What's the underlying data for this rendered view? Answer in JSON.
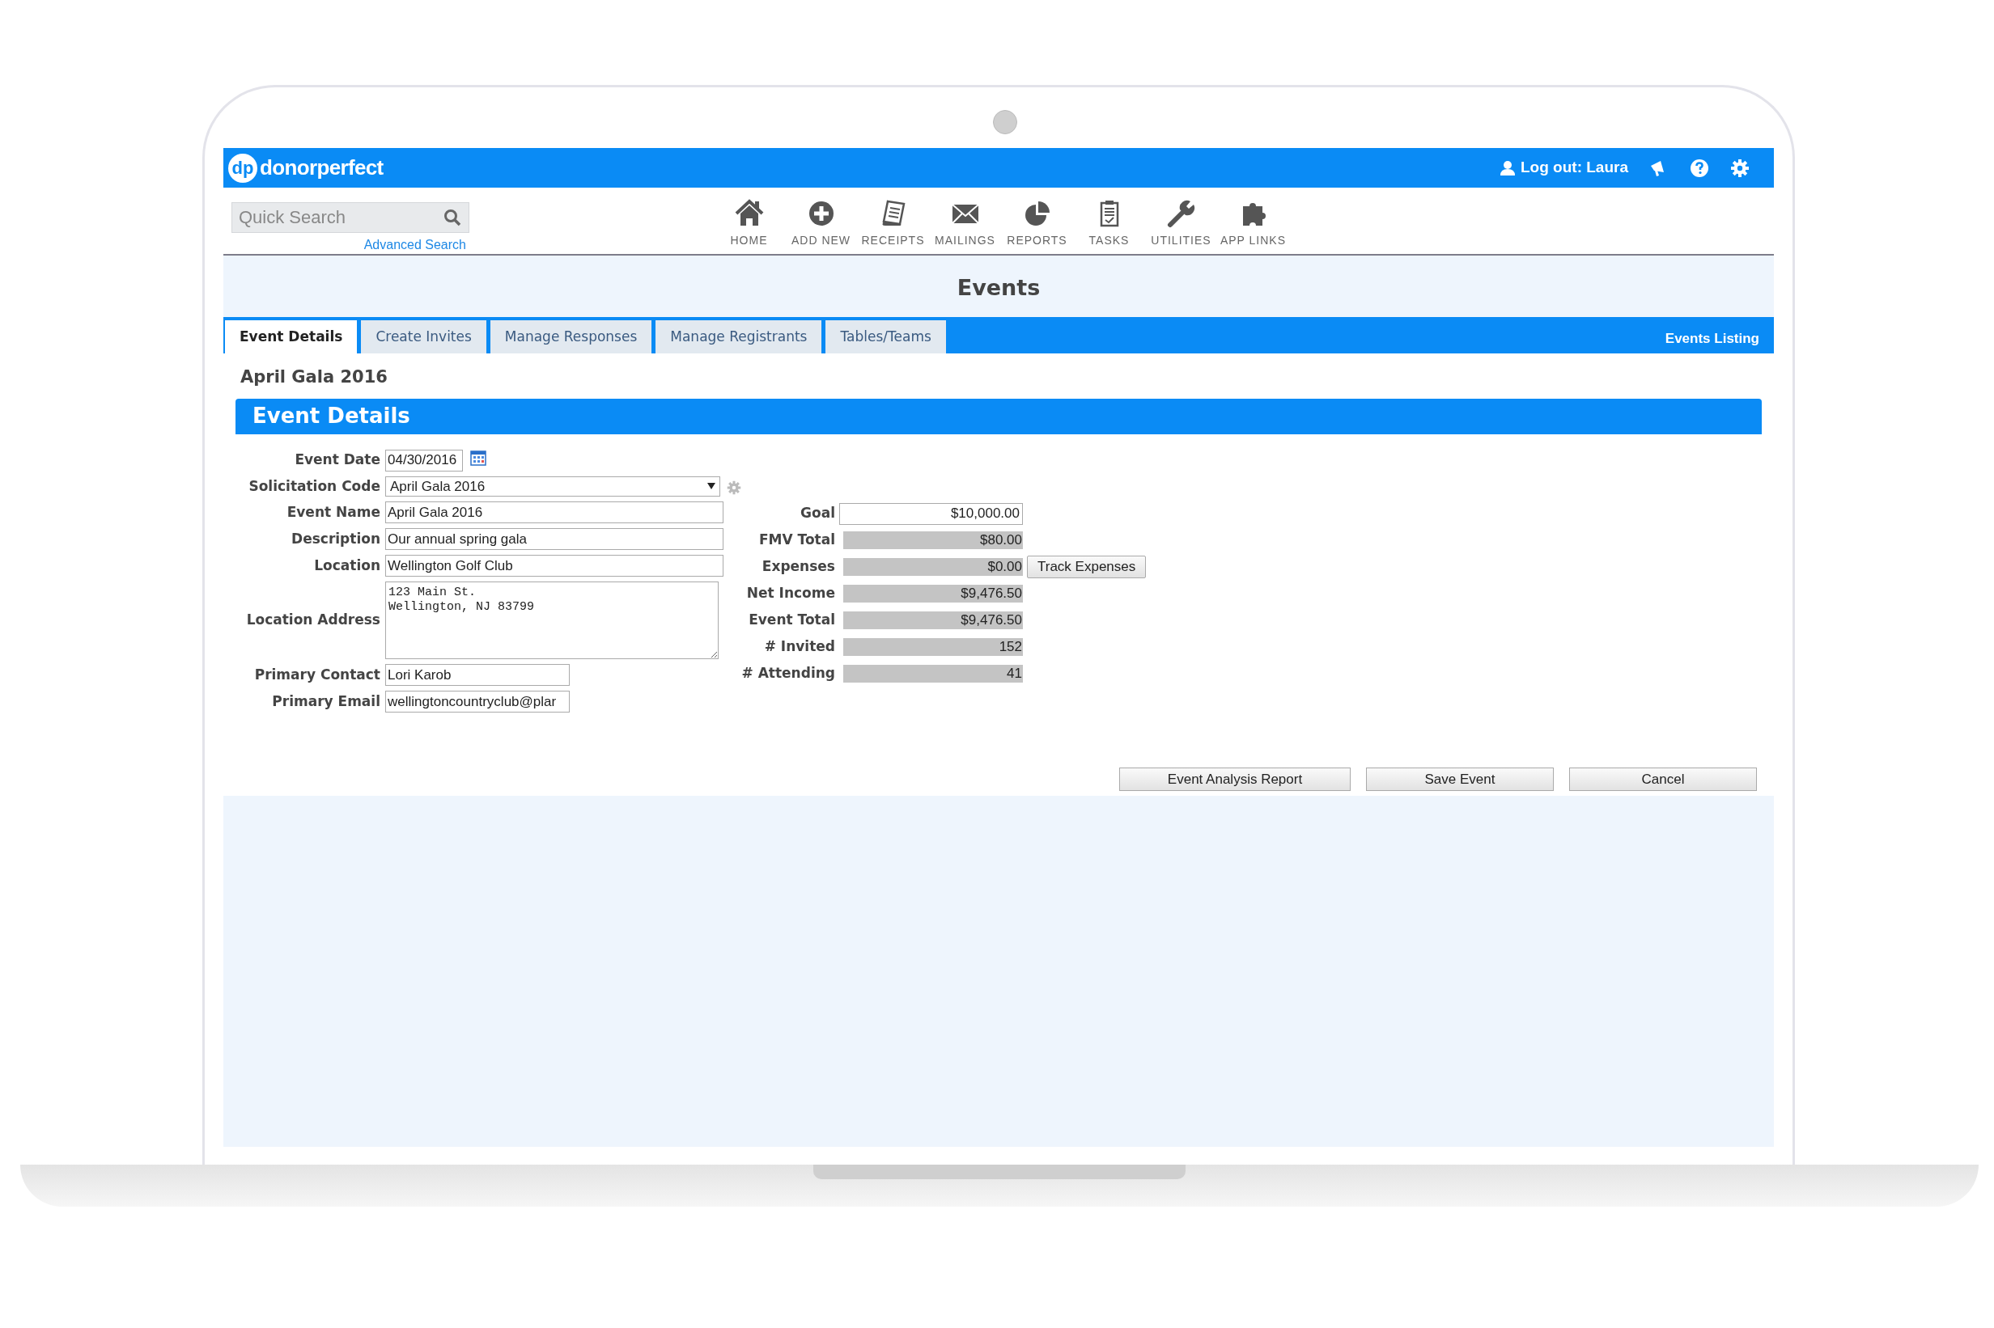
{
  "header": {
    "logo_mark": "dp",
    "logo_text": "donorperfect",
    "user": "Log out: Laura"
  },
  "search": {
    "placeholder": "Quick Search",
    "link": "Advanced Search"
  },
  "nav": [
    {
      "label": "HOME"
    },
    {
      "label": "ADD NEW"
    },
    {
      "label": "RECEIPTS"
    },
    {
      "label": "MAILINGS"
    },
    {
      "label": "REPORTS"
    },
    {
      "label": "TASKS"
    },
    {
      "label": "UTILITIES"
    },
    {
      "label": "APP LINKS"
    }
  ],
  "page_title": "Events",
  "tabs": [
    {
      "label": "Event Details",
      "selected": true
    },
    {
      "label": "Create Invites",
      "selected": false
    },
    {
      "label": "Manage Responses",
      "selected": false
    },
    {
      "label": "Manage Registrants",
      "selected": false
    },
    {
      "label": "Tables/Teams",
      "selected": false
    }
  ],
  "events_listing": "Events Listing",
  "record_title": "April Gala 2016",
  "section_title": "Event Details",
  "left_fields": [
    {
      "label": "Event Date",
      "value": "04/30/2016",
      "kind": "date"
    },
    {
      "label": "Solicitation Code",
      "value": "April Gala 2016",
      "kind": "select"
    },
    {
      "label": "Event Name",
      "value": "April Gala 2016",
      "kind": "text"
    },
    {
      "label": "Description",
      "value": "Our annual spring gala",
      "kind": "text"
    },
    {
      "label": "Location",
      "value": "Wellington Golf Club",
      "kind": "text"
    },
    {
      "label": "Location Address",
      "value": "123 Main St.\nWellington, NJ 83799",
      "kind": "textarea"
    },
    {
      "label": "Primary Contact",
      "value": "Lori Karob",
      "kind": "short"
    },
    {
      "label": "Primary Email",
      "value": "wellingtoncountryclub@plar",
      "kind": "short"
    }
  ],
  "right_fields": [
    {
      "label": "Goal",
      "value": "$10,000.00",
      "kind": "input"
    },
    {
      "label": "FMV Total",
      "value": "$80.00",
      "kind": "readonly"
    },
    {
      "label": "Expenses",
      "value": "$0.00",
      "kind": "readonly",
      "button": "Track Expenses"
    },
    {
      "label": "Net Income",
      "value": "$9,476.50",
      "kind": "readonly"
    },
    {
      "label": "Event Total",
      "value": "$9,476.50",
      "kind": "readonly"
    },
    {
      "label": "# Invited",
      "value": "152",
      "kind": "readonly"
    },
    {
      "label": "# Attending",
      "value": "41",
      "kind": "readonly"
    }
  ],
  "buttons": [
    "Event Analysis Report",
    "Save Event",
    "Cancel"
  ]
}
